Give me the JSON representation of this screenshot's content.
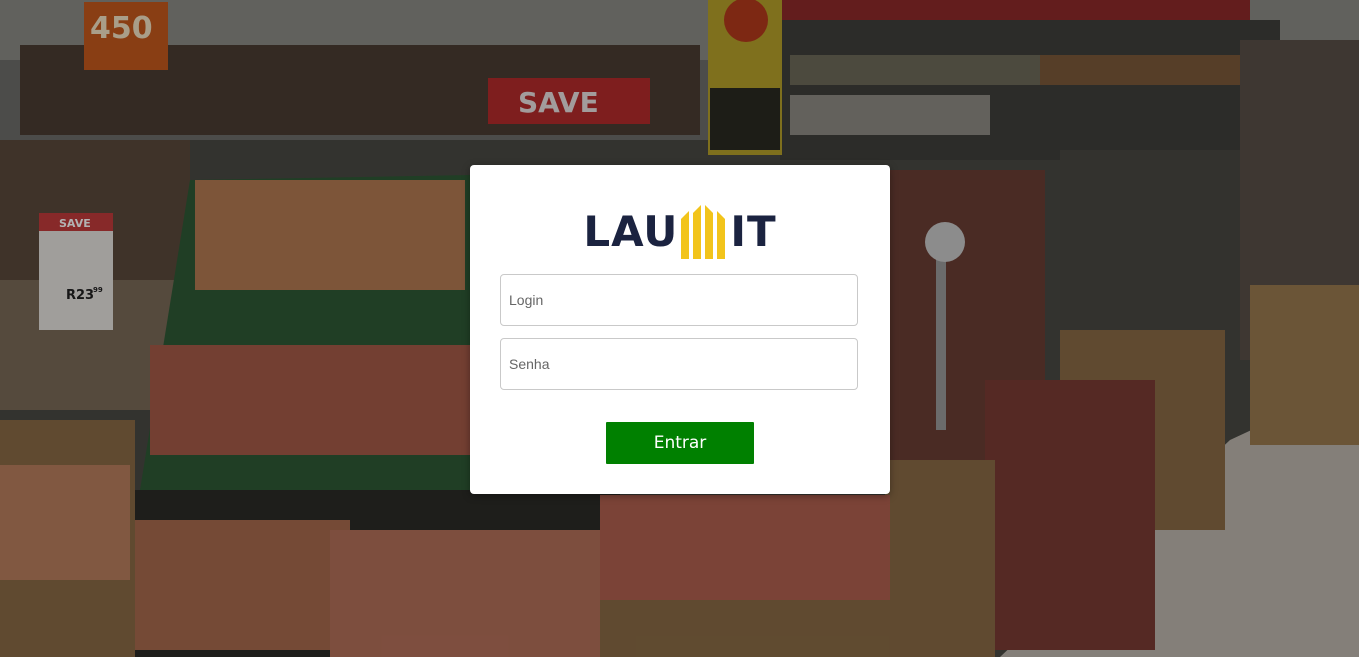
{
  "background": {
    "description_icon": "supermarket-produce-photo",
    "price_sign": {
      "label": "SAVE",
      "price": "R23",
      "cents": "99"
    },
    "banner_sign": "SAVE",
    "corner_sign": "450"
  },
  "logo": {
    "left_text": "LAU",
    "right_text": "IT",
    "mark_color": "#f2c41b",
    "text_color": "#1b2340"
  },
  "form": {
    "login_placeholder": "Login",
    "password_placeholder": "Senha",
    "submit_label": "Entrar",
    "submit_color": "#008000"
  }
}
